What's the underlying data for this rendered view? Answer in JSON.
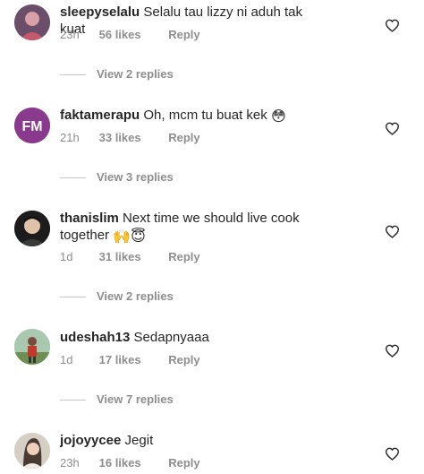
{
  "comments": [
    {
      "username": "sleepyselalu",
      "text": "Selalu tau lizzy ni aduh tak kuat",
      "time": "23h",
      "likes": "56 likes",
      "reply": "Reply",
      "view_replies": "View 2 replies"
    },
    {
      "username": "faktamerapu",
      "text": "Oh, mcm tu buat kek",
      "emoji": "😳",
      "avatar_text": "FM",
      "time": "21h",
      "likes": "33 likes",
      "reply": "Reply",
      "view_replies": "View 3 replies"
    },
    {
      "username": "thanislim",
      "text_line1": "Next time we should live cook",
      "text_line2": "together",
      "emoji": "🙌😇",
      "time": "1d",
      "likes": "31 likes",
      "reply": "Reply",
      "view_replies": "View 2 replies"
    },
    {
      "username": "udeshah13",
      "text": "Sedapnyaaa",
      "time": "1d",
      "likes": "17 likes",
      "reply": "Reply",
      "view_replies": "View 7 replies"
    },
    {
      "username": "jojoyycee",
      "text": "Jegit",
      "time": "23h",
      "likes": "16 likes",
      "reply": "Reply"
    }
  ],
  "colors": {
    "text": "#262626",
    "meta": "#8e8e8e",
    "brand_fm": "#8a3a8c"
  }
}
